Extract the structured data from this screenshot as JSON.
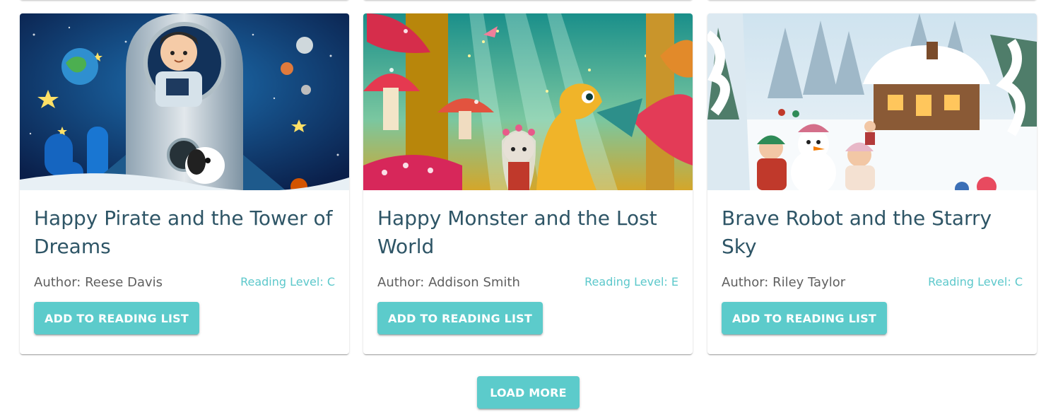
{
  "books": [
    {
      "title": "Happy Pirate and the Tower of Dreams",
      "author": "Author: Reese Davis",
      "level": "Reading Level: C",
      "button_label": "Add to Reading List",
      "image": "space-rocket-astronaut-illustration"
    },
    {
      "title": "Happy Monster and the Lost World",
      "author": "Author: Addison Smith",
      "level": "Reading Level: E",
      "button_label": "Add to Reading List",
      "image": "mushroom-forest-dragon-illustration"
    },
    {
      "title": "Brave Robot and the Starry Sky",
      "author": "Author: Riley Taylor",
      "level": "Reading Level: C",
      "button_label": "Add to Reading List",
      "image": "snowy-village-snowman-illustration"
    }
  ],
  "pagination": {
    "load_more_label": "Load More"
  },
  "colors": {
    "accent": "#5ccbcb",
    "title_text": "#2e5566",
    "author_text": "#5f5f5f",
    "level_text": "#5cc8cb"
  }
}
